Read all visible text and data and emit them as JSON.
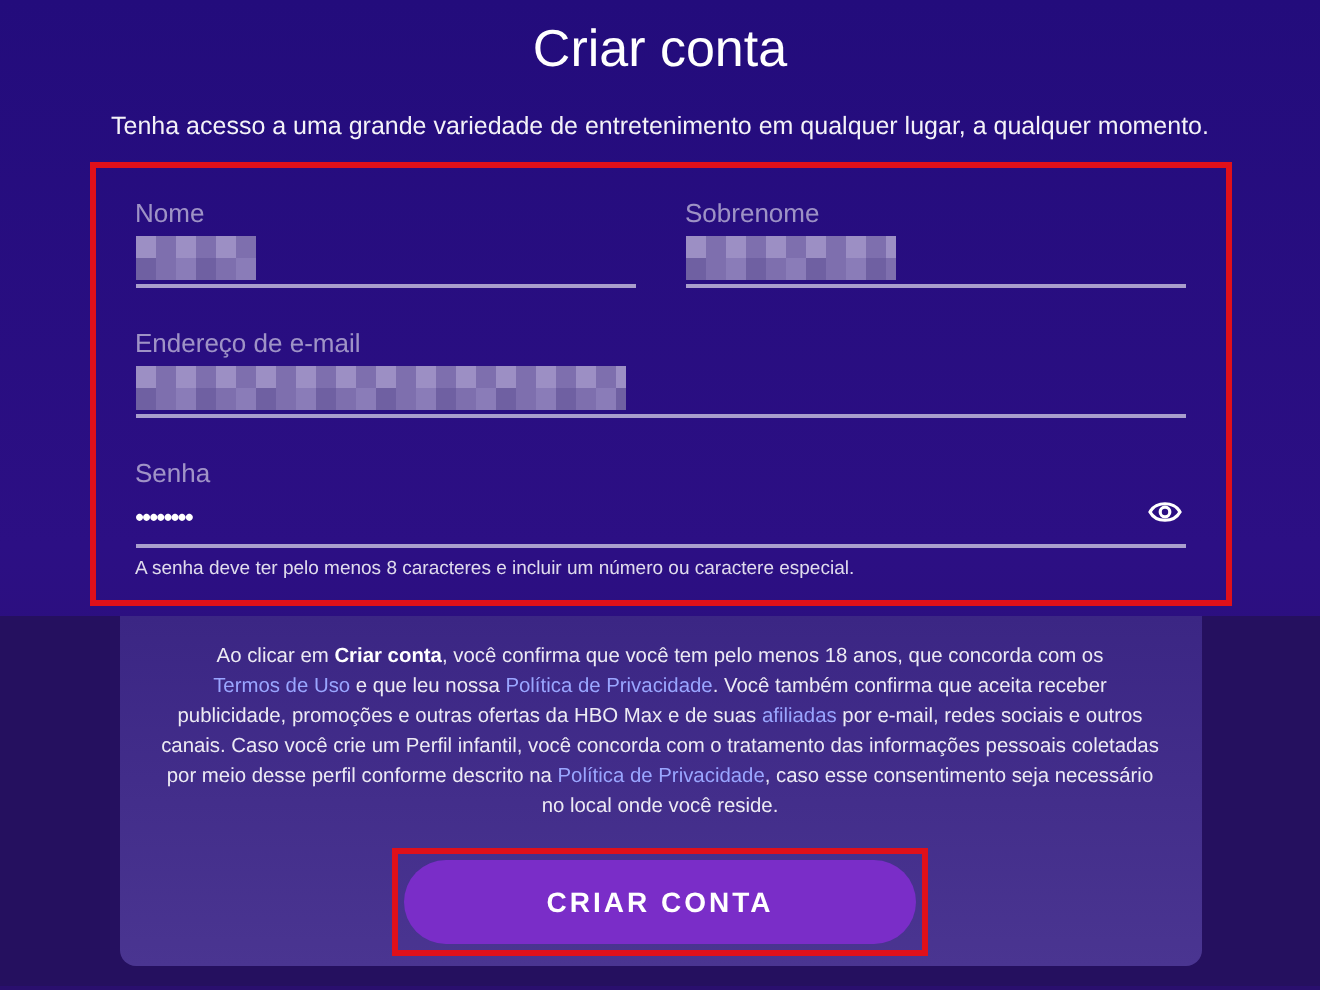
{
  "title": "Criar conta",
  "subtitle": "Tenha acesso a uma grande variedade de entretenimento em qualquer lugar, a qualquer momento.",
  "form": {
    "highlighted": true,
    "fields": [
      {
        "label": "Nome",
        "redacted": true,
        "kind": "text"
      },
      {
        "label": "Sobrenome",
        "redacted": true,
        "kind": "text"
      },
      {
        "label": "Endereço de e-mail",
        "redacted": true,
        "kind": "text"
      },
      {
        "label": "Senha",
        "value": "••••••••",
        "kind": "password"
      }
    ],
    "hint": "A senha deve ter pelo menos 8 caracteres e incluir um número ou caractere especial."
  },
  "terms": [
    {
      "kind": "plain",
      "text": "Ao clicar em "
    },
    {
      "kind": "bold",
      "text": "Criar conta"
    },
    {
      "kind": "plain",
      "text": ", você confirma que você tem pelo menos 18 anos, que concorda com os "
    },
    {
      "kind": "link",
      "text": "Termos de Uso"
    },
    {
      "kind": "plain",
      "text": " e que leu nossa "
    },
    {
      "kind": "link",
      "text": "Política de Privacidade"
    },
    {
      "kind": "plain",
      "text": ". Você também confirma que aceita receber publicidade, promoções e outras ofertas da HBO Max e de suas "
    },
    {
      "kind": "link",
      "text": "afiliadas"
    },
    {
      "kind": "plain",
      "text": " por e-mail, redes sociais e outros canais. Caso você crie um Perfil infantil, você concorda com o tratamento das informações pessoais coletadas por meio desse perfil conforme descrito na "
    },
    {
      "kind": "link",
      "text": "Política de Privacidade"
    },
    {
      "kind": "plain",
      "text": ", caso esse consentimento seja necessário no local onde você reside."
    }
  ],
  "button": {
    "label": "CRIAR CONTA",
    "highlighted": true
  }
}
